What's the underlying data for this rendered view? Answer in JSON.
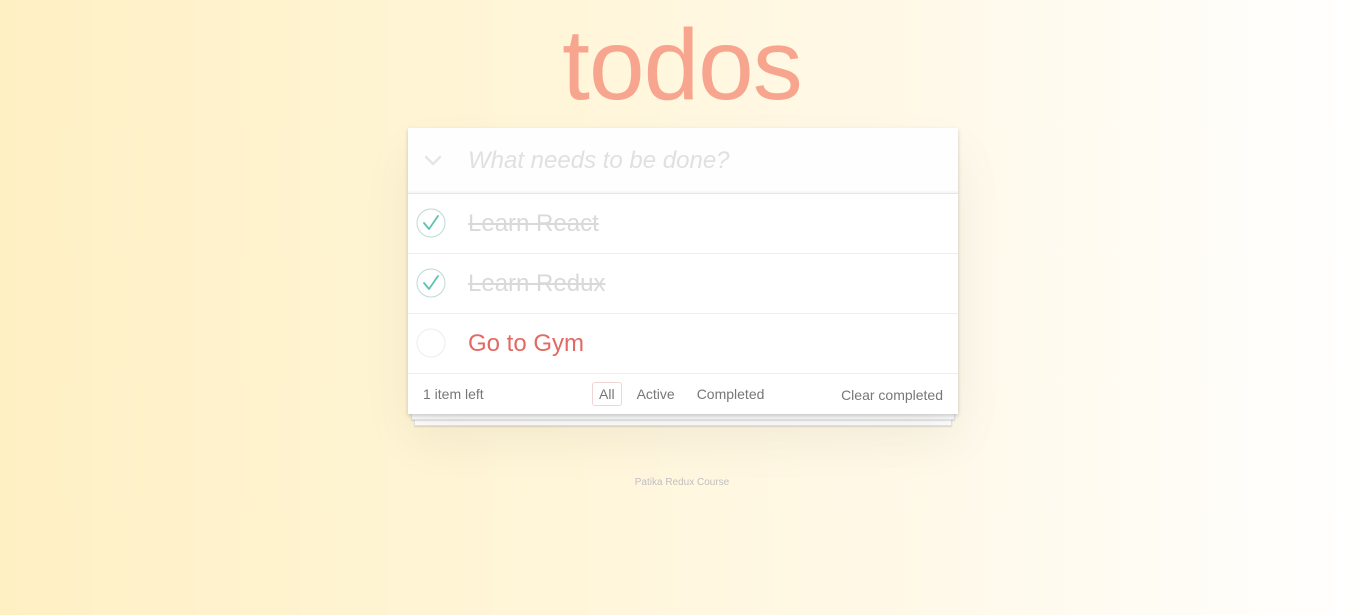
{
  "app": {
    "title": "todos"
  },
  "input": {
    "placeholder": "What needs to be done?",
    "value": ""
  },
  "todos": [
    {
      "label": "Learn React",
      "completed": true
    },
    {
      "label": "Learn Redux",
      "completed": true
    },
    {
      "label": "Go to Gym",
      "completed": false
    }
  ],
  "footer": {
    "count_text": "1 item left",
    "filters": [
      {
        "label": "All",
        "selected": true
      },
      {
        "label": "Active",
        "selected": false
      },
      {
        "label": "Completed",
        "selected": false
      }
    ],
    "clear_label": "Clear completed"
  },
  "page_footer": {
    "text": "Patika Redux Course"
  },
  "colors": {
    "title": "#f7a58e",
    "active_item": "#e26a63",
    "completed_item": "#d9d9d9",
    "check": "#5dc2af"
  },
  "icons": {
    "toggle_all": "chevron-down-icon",
    "checked": "check-circle-icon",
    "unchecked": "empty-circle-icon"
  }
}
